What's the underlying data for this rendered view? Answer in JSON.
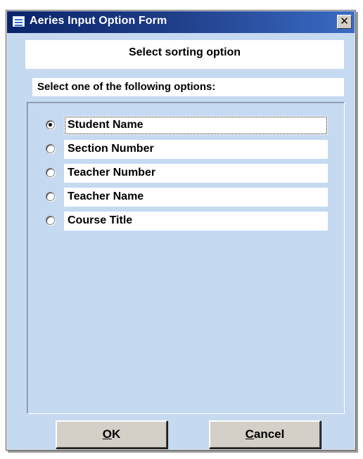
{
  "window": {
    "title": "Aeries Input Option Form",
    "close_glyph": "✕"
  },
  "header": {
    "title": "Select sorting option"
  },
  "instruction": "Select one of the following options:",
  "options": [
    {
      "label": "Student Name",
      "selected": true
    },
    {
      "label": "Section Number",
      "selected": false
    },
    {
      "label": "Teacher Number",
      "selected": false
    },
    {
      "label": "Teacher Name",
      "selected": false
    },
    {
      "label": "Course Title",
      "selected": false
    }
  ],
  "buttons": {
    "ok": {
      "accel": "O",
      "rest": "K"
    },
    "cancel": {
      "accel": "C",
      "rest": "ancel"
    }
  },
  "colors": {
    "form_background": "#c5d9f1",
    "titlebar_start": "#0a246a",
    "titlebar_end": "#3a6bc4",
    "button_face": "#d4d0c8"
  },
  "icons": {
    "title": "form-icon",
    "close": "close-icon"
  }
}
